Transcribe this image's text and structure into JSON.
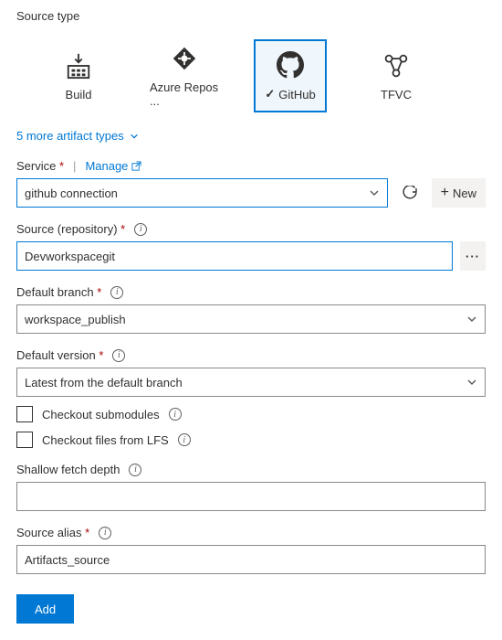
{
  "header": {
    "source_type": "Source type"
  },
  "tiles": {
    "build": "Build",
    "azure_repos": "Azure Repos ...",
    "github": "GitHub",
    "tfvc": "TFVC"
  },
  "more_artifacts": "5 more artifact types",
  "service": {
    "label": "Service",
    "manage": "Manage",
    "value": "github connection",
    "new": "New"
  },
  "source_repo": {
    "label": "Source (repository)",
    "value": "Devworkspacegit"
  },
  "default_branch": {
    "label": "Default branch",
    "value": "workspace_publish"
  },
  "default_version": {
    "label": "Default version",
    "value": "Latest from the default branch"
  },
  "checkboxes": {
    "submodules": "Checkout submodules",
    "lfs": "Checkout files from LFS"
  },
  "shallow_fetch": {
    "label": "Shallow fetch depth",
    "value": ""
  },
  "source_alias": {
    "label": "Source alias",
    "value": "Artifacts_source"
  },
  "add_button": "Add"
}
